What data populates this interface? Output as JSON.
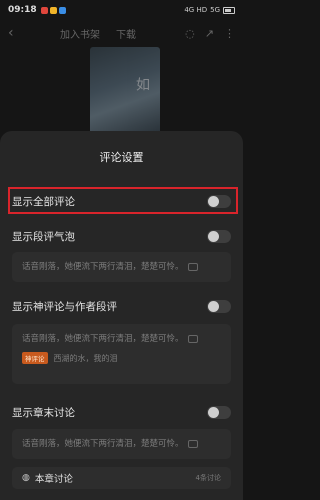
{
  "status_bar": {
    "time": "09:18",
    "network": "4G HD",
    "signal": "5G"
  },
  "top_nav": {
    "add_shelf": "加入书架",
    "download": "下载"
  },
  "cover": {
    "title": "如"
  },
  "sheet": {
    "title": "评论设置",
    "settings": [
      {
        "label": "显示全部评论",
        "enabled": false
      },
      {
        "label": "显示段评气泡",
        "enabled": false
      },
      {
        "label": "显示神评论与作者段评",
        "enabled": false
      },
      {
        "label": "显示章末讨论",
        "enabled": false
      }
    ],
    "preview_text": "话音刚落，她便流下两行清泪，楚楚可怜。",
    "god_comment": {
      "tag": "神评论",
      "text": "西湖的水，我的泪"
    },
    "chapter_discussion": {
      "label": "本章讨论",
      "count": "4条讨论"
    }
  },
  "colors": {
    "highlight": "#d9242b",
    "tag": "#c85a1e"
  }
}
